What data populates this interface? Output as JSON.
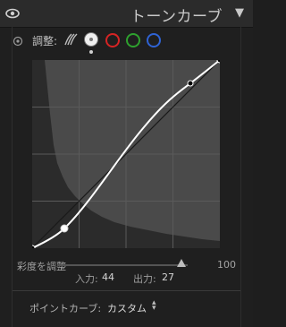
{
  "panel": {
    "title": "トーンカーブ",
    "collapse_glyph": "▼"
  },
  "adjust": {
    "label": "調整:",
    "channels": [
      "parametric",
      "point-rgb",
      "red",
      "green",
      "blue"
    ],
    "selected_channel": "point-rgb"
  },
  "curve": {
    "points": [
      {
        "input": 0,
        "output": 0
      },
      {
        "input": 44,
        "output": 27
      },
      {
        "input": 216,
        "output": 236
      },
      {
        "input": 255,
        "output": 255
      }
    ],
    "selected_point": {
      "input": 44,
      "output": 27
    }
  },
  "saturation": {
    "label": "彩度を調整",
    "value": "100",
    "fraction": 0.9
  },
  "io": {
    "input_label": "入力:",
    "input_value": "44",
    "output_label": "出力:",
    "output_value": "27"
  },
  "point_curve": {
    "label": "ポイントカーブ:",
    "value": "カスタム"
  },
  "colors": {
    "red": "#d62424",
    "green": "#2ea12e",
    "blue": "#2f63d4",
    "graph_bg": "#4a4a4a",
    "histogram": "#2b2b2b"
  }
}
